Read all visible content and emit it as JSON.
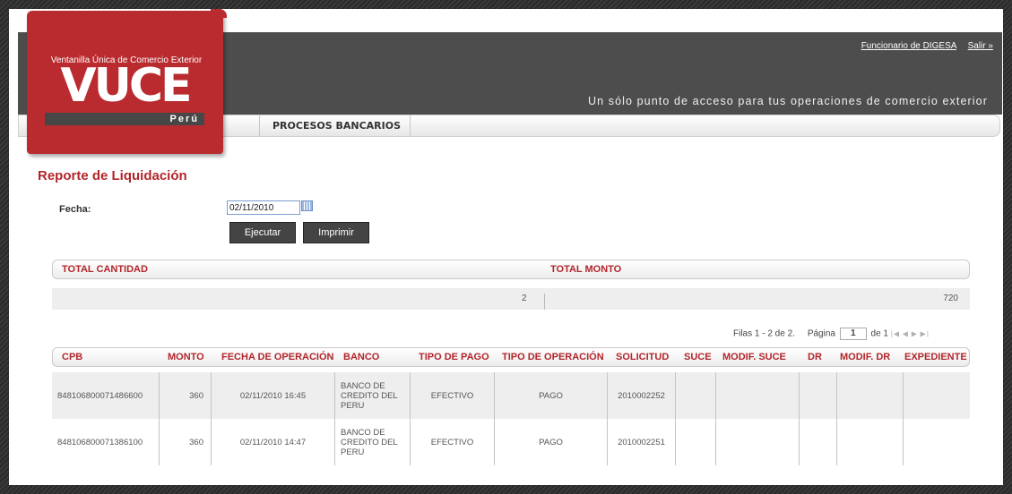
{
  "header": {
    "user_link": "Funcionario de DIGESA",
    "logout_link": "Salir »",
    "tagline": "Un sólo punto de acceso para tus operaciones de comercio exterior"
  },
  "logo": {
    "subtitle": "Ventanilla Única de Comercio Exterior",
    "mark": "VUCE",
    "country": "Perú",
    "color": "#b92b2f"
  },
  "nav": {
    "item": "PROCESOS BANCARIOS"
  },
  "page_title": "Reporte de Liquidación",
  "form": {
    "fecha_label": "Fecha:",
    "fecha_value": "02/11/2010",
    "calendar_icon": "calendar-icon",
    "execute_label": "Ejecutar",
    "print_label": "Imprimir"
  },
  "totals": {
    "headers": [
      "TOTAL CANTIDAD",
      "TOTAL MONTO"
    ],
    "cantidad": "2",
    "monto": "720"
  },
  "pager": {
    "rows_text": "Filas 1 - 2 de 2.",
    "page_label": "Página",
    "page_value": "1",
    "of_text": "de 1",
    "nav_icons": [
      "first-page-icon",
      "prev-page-icon",
      "next-page-icon",
      "last-page-icon"
    ]
  },
  "table": {
    "columns": [
      "CPB",
      "MONTO",
      "FECHA DE OPERACIÓN",
      "BANCO",
      "TIPO DE PAGO",
      "TIPO DE OPERACIÓN",
      "SOLICITUD",
      "SUCE",
      "MODIF. SUCE",
      "DR",
      "MODIF. DR",
      "EXPEDIENTE"
    ],
    "rows": [
      {
        "cpb": "848106800071486600",
        "monto": "360",
        "fecha": "02/11/2010 16:45",
        "banco": "BANCO DE CREDITO DEL PERU",
        "tipo_pago": "EFECTIVO",
        "tipo_operacion": "PAGO",
        "solicitud": "2010002252",
        "suce": "",
        "modif_suce": "",
        "dr": "",
        "modif_dr": "",
        "expediente": ""
      },
      {
        "cpb": "848106800071386100",
        "monto": "360",
        "fecha": "02/11/2010 14:47",
        "banco": "BANCO DE CREDITO DEL PERU",
        "tipo_pago": "EFECTIVO",
        "tipo_operacion": "PAGO",
        "solicitud": "2010002251",
        "suce": "",
        "modif_suce": "",
        "dr": "",
        "modif_dr": "",
        "expediente": ""
      }
    ]
  },
  "colors": {
    "accent": "#b2252b",
    "header_bg": "#4d4d4d",
    "row_alt": "#eeeeee"
  }
}
